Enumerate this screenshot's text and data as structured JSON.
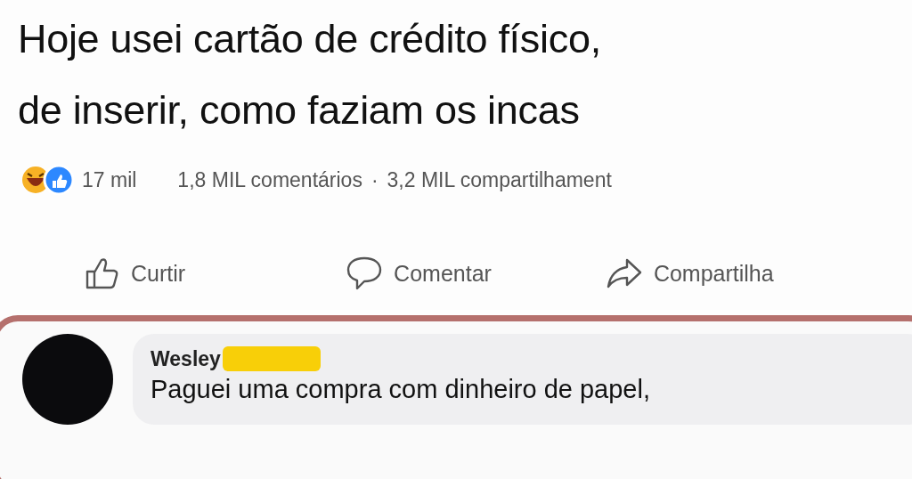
{
  "post": {
    "text_lines": [
      "Hoje usei cartão de crédito físico,",
      "de inserir, como faziam os incas"
    ],
    "reactions": {
      "count": "17 mil"
    },
    "comments_count": "1,8 MIL comentários",
    "separator": "·",
    "shares_count": "3,2 MIL compartilhament"
  },
  "actions": [
    {
      "kind": "like",
      "label": "Curtir"
    },
    {
      "kind": "comment",
      "label": "Comentar"
    },
    {
      "kind": "share",
      "label": "Compartilha"
    }
  ],
  "comment": {
    "author": "Wesley",
    "text": "Paguei uma compra com dinheiro de papel,"
  }
}
